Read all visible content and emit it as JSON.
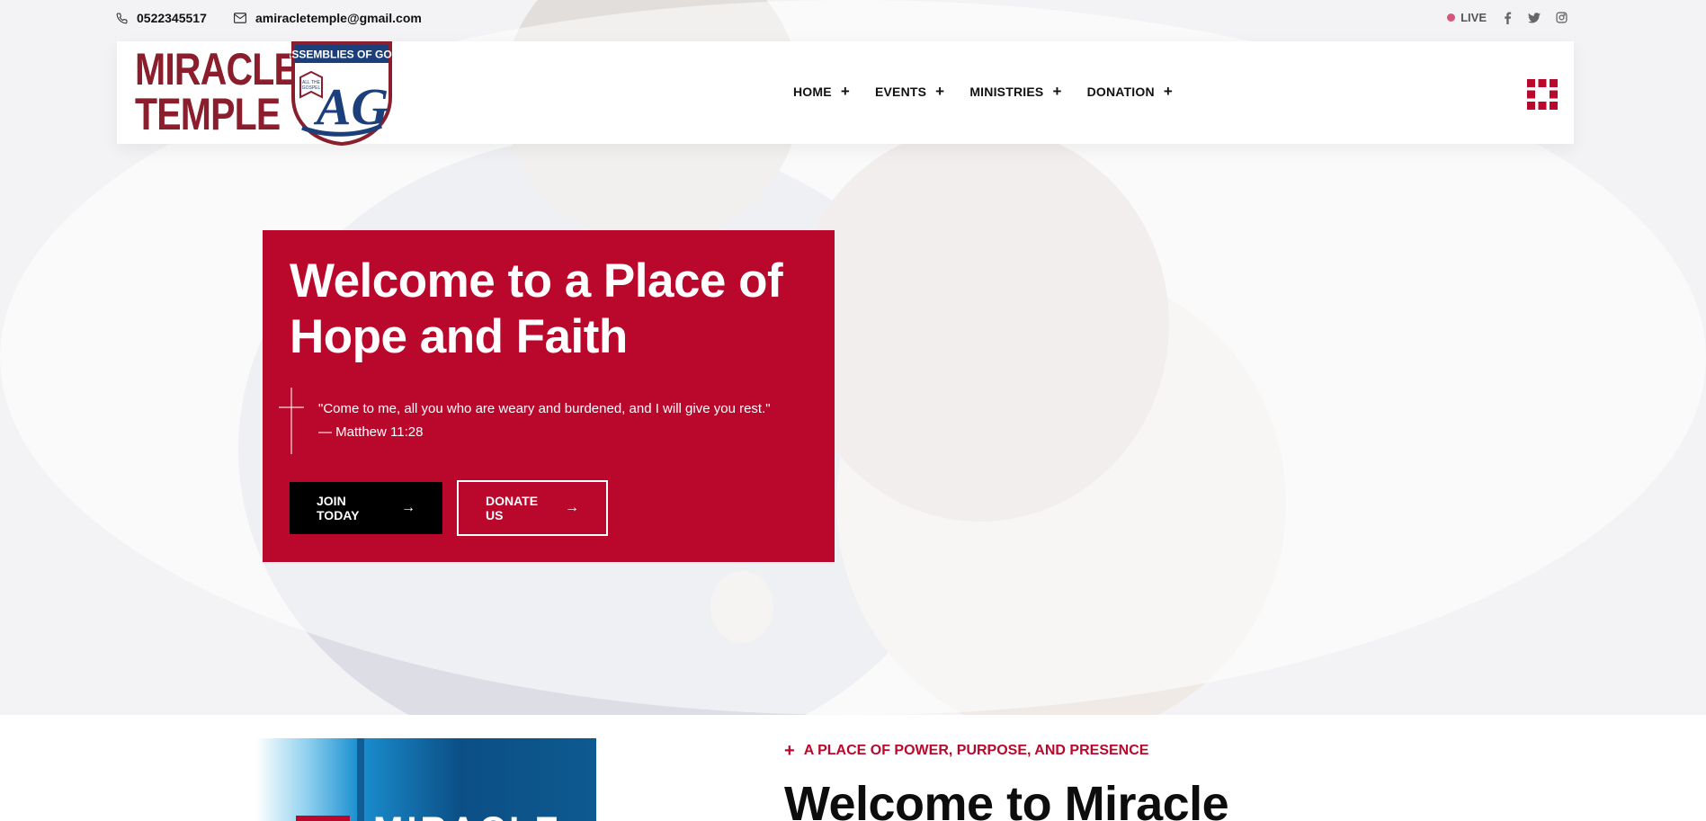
{
  "topbar": {
    "phone": "0522345517",
    "email": "amiracletemple@gmail.com",
    "live_label": "LIVE",
    "social_icons": [
      "facebook-icon",
      "twitter-icon",
      "instagram-icon"
    ]
  },
  "header": {
    "logo_line1": "MIRACLE",
    "logo_line2": "TEMPLE",
    "badge_top": "ASSEMBLIES OF GOD",
    "badge_mark": "AG",
    "badge_book_line1": "ALL THE",
    "badge_book_line2": "GOSPEL",
    "nav": [
      {
        "label": "HOME"
      },
      {
        "label": "EVENTS"
      },
      {
        "label": "MINISTRIES"
      },
      {
        "label": "DONATION"
      }
    ]
  },
  "hero": {
    "title": "Welcome to a Place of Hope and Faith",
    "quote": "\"Come to me, all you who are weary and burdened, and I will give you rest.\" — Matthew 11:28",
    "join_label": "JOIN TODAY",
    "donate_label": "DONATE US"
  },
  "section2": {
    "promo_text": "MIRACLE",
    "tagline": "A PLACE OF POWER, PURPOSE, AND PRESENCE",
    "heading": "Welcome to Miracle"
  },
  "colors": {
    "brand_red": "#ba082c",
    "logo_maroon": "#8a1e2c",
    "badge_blue": "#1b3f7a"
  }
}
